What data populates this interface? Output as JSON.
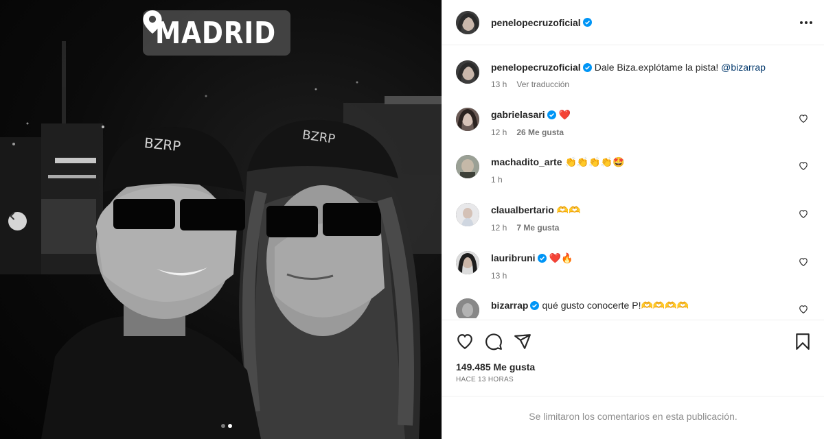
{
  "media": {
    "location": "MADRID",
    "cap_left": "BZRP",
    "cap_right": "BZRP"
  },
  "header": {
    "username": "penelopecruzoficial",
    "avatar": "avatar-penelope",
    "verified_color": "#0095f6"
  },
  "caption": {
    "username": "penelopecruzoficial",
    "text": "Dale Biza.explótame la pista!",
    "mention": "@bizarrap",
    "time": "13 h",
    "translate": "Ver traducción"
  },
  "comments": [
    {
      "username": "gabrielasari",
      "text": "❤️",
      "time": "12 h",
      "likes": "26 Me gusta",
      "verified": true
    },
    {
      "username": "machadito_arte",
      "text": "👏👏👏👏🤩",
      "time": "1 h",
      "likes": "",
      "verified": false
    },
    {
      "username": "claualbertario",
      "text": "🫶🫶",
      "time": "12 h",
      "likes": "7 Me gusta",
      "verified": false
    },
    {
      "username": "lauribruni",
      "text": "❤️🔥",
      "time": "13 h",
      "likes": "",
      "verified": true
    },
    {
      "username": "bizarrap",
      "text": "qué gusto conocerte P!🫶🫶🫶🫶",
      "time": "",
      "likes": "",
      "verified": true
    }
  ],
  "actions": {
    "likes": "149.485 Me gusta",
    "posted": "HACE 13 HORAS",
    "limited": "Se limitaron los comentarios en esta publicación."
  },
  "icons": [
    "location-pin-icon",
    "chevron-left-icon",
    "more-icon",
    "heart-icon",
    "comment-icon",
    "share-icon",
    "bookmark-icon",
    "verified-icon"
  ]
}
